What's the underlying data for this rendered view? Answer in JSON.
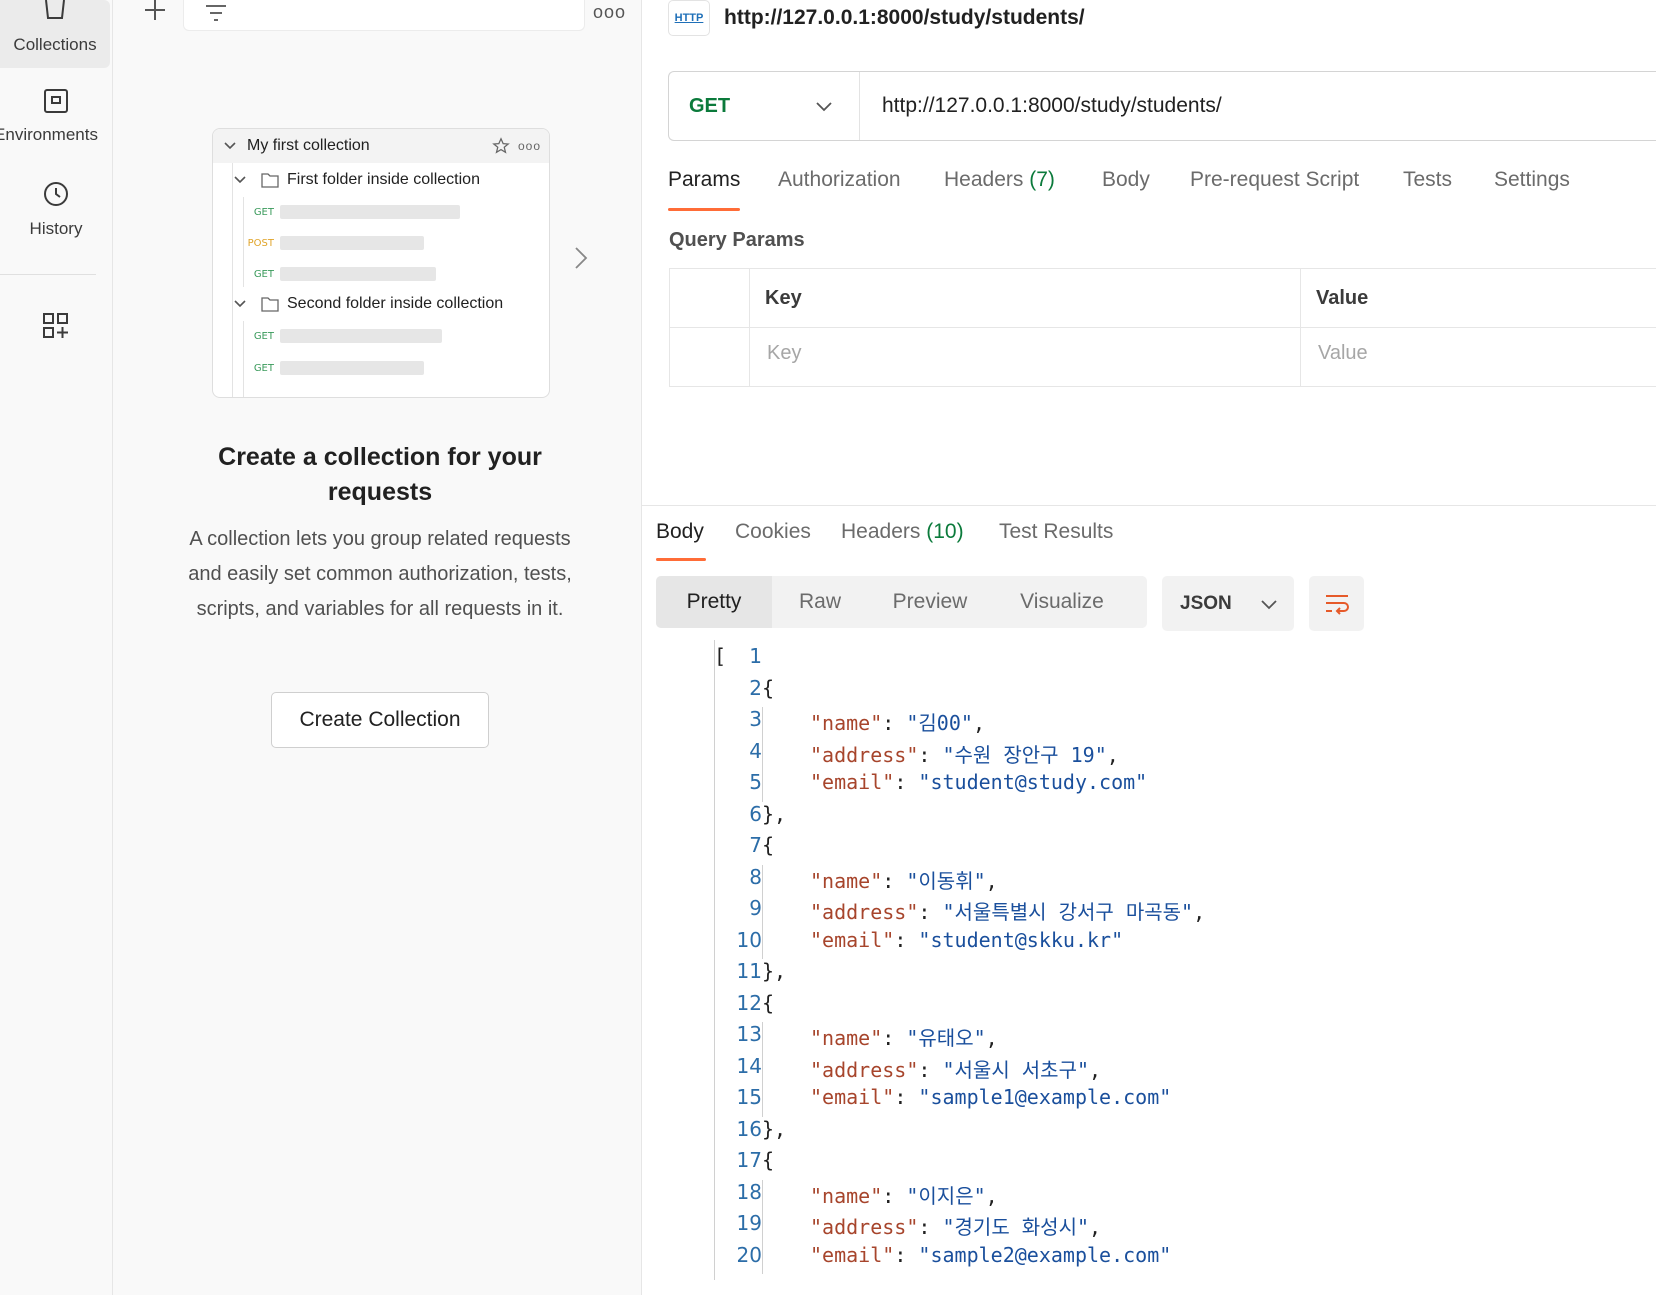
{
  "rail": {
    "items": [
      {
        "label": "Collections",
        "icon": "collections-icon"
      },
      {
        "label": "Environments",
        "icon": "environments-icon"
      },
      {
        "label": "History",
        "icon": "history-icon"
      }
    ],
    "extra_icon": "add-workspace-icon"
  },
  "pane": {
    "more_label": "ooo",
    "preview": {
      "collection": "My first collection",
      "folders": [
        {
          "name": "First folder inside collection",
          "requests": [
            "GET",
            "POST",
            "GET"
          ]
        },
        {
          "name": "Second folder inside collection",
          "requests": [
            "GET",
            "GET"
          ]
        }
      ]
    },
    "cta_title": "Create a collection for your requests",
    "cta_description": "A collection lets you group related requests and easily set common authorization, tests, scripts, and variables for all requests in it.",
    "cta_button": "Create Collection"
  },
  "request": {
    "badge": "HTTP",
    "title": "http://127.0.0.1:8000/study/students/",
    "method": "GET",
    "url": "http://127.0.0.1:8000/study/students/",
    "tabs": [
      {
        "label": "Params",
        "count": ""
      },
      {
        "label": "Authorization",
        "count": ""
      },
      {
        "label": "Headers",
        "count": "(7)"
      },
      {
        "label": "Body",
        "count": ""
      },
      {
        "label": "Pre-request Script",
        "count": ""
      },
      {
        "label": "Tests",
        "count": ""
      },
      {
        "label": "Settings",
        "count": ""
      }
    ],
    "query_params_label": "Query Params",
    "columns": {
      "key": "Key",
      "value": "Value"
    },
    "placeholders": {
      "key": "Key",
      "value": "Value"
    }
  },
  "response": {
    "tabs": [
      {
        "label": "Body",
        "count": ""
      },
      {
        "label": "Cookies",
        "count": ""
      },
      {
        "label": "Headers",
        "count": "(10)"
      },
      {
        "label": "Test Results",
        "count": ""
      }
    ],
    "views": [
      "Pretty",
      "Raw",
      "Preview",
      "Visualize"
    ],
    "format": "JSON",
    "line_numbers": [
      "1",
      "2",
      "3",
      "4",
      "5",
      "6",
      "7",
      "8",
      "9",
      "10",
      "11",
      "12",
      "13",
      "14",
      "15",
      "16",
      "17",
      "18",
      "19",
      "20"
    ],
    "records": [
      {
        "name": "김00",
        "address": "수원 장안구 19",
        "email": "student@study.com"
      },
      {
        "name": "이동휘",
        "address": "서울특별시 강서구 마곡동",
        "email": "student@skku.kr"
      },
      {
        "name": "유태오",
        "address": "서울시 서초구",
        "email": "sample1@example.com"
      },
      {
        "name": "이지은",
        "address": "경기도 화성시",
        "email": "sample2@example.com"
      }
    ]
  },
  "colors": {
    "accent": "#ff6c37",
    "method_get": "#0b7a3b",
    "json_key": "#a7452c",
    "json_string": "#1a4f9c"
  }
}
